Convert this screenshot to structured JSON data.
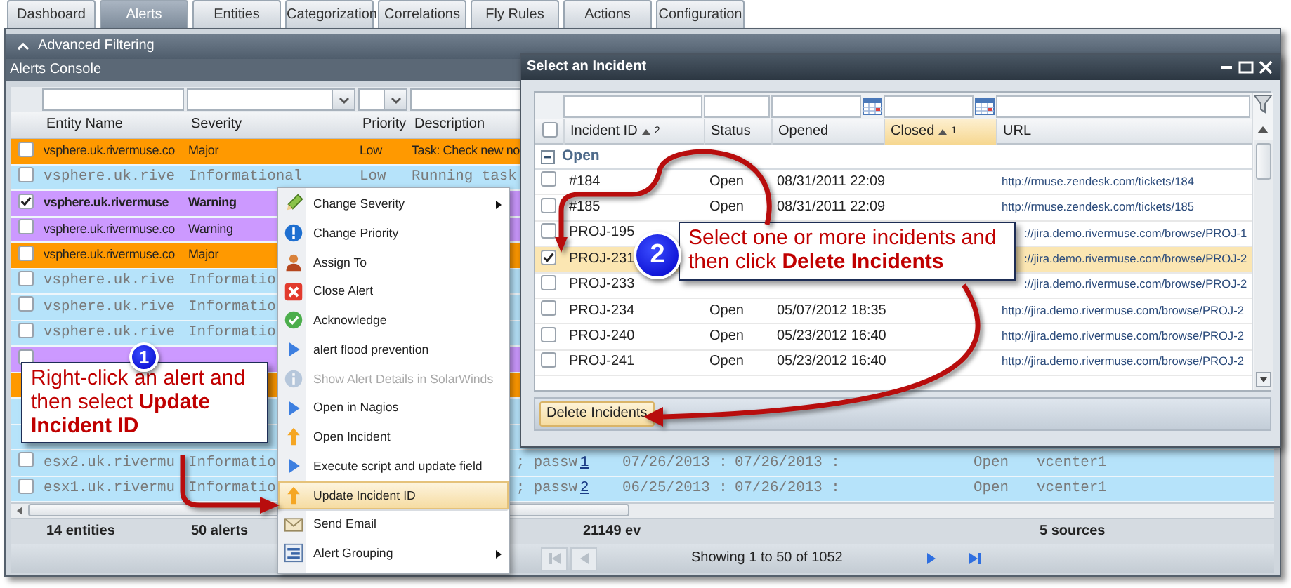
{
  "tabs": [
    {
      "label": "Dashboard",
      "selected": false
    },
    {
      "label": "Alerts",
      "selected": true
    },
    {
      "label": "Entities",
      "selected": false
    },
    {
      "label": "Categorization",
      "selected": false
    },
    {
      "label": "Correlations",
      "selected": false
    },
    {
      "label": "Fly Rules",
      "selected": false
    },
    {
      "label": "Actions",
      "selected": false
    },
    {
      "label": "Configuration",
      "selected": false
    }
  ],
  "filter_panel": {
    "title": "Advanced Filtering",
    "expanded": true
  },
  "console": {
    "title": "Alerts Console",
    "columns": [
      {
        "label": "Entity Name",
        "kind": "text"
      },
      {
        "label": "Severity",
        "kind": "select"
      },
      {
        "label": "Priority",
        "kind": "select"
      },
      {
        "label": "Description",
        "kind": "text"
      }
    ],
    "rows": [
      {
        "kind": "normal",
        "color": "#ff9900",
        "checked": false,
        "selected": false,
        "entity": "vsphere.uk.rivermuse.co",
        "severity": "Major",
        "priority": "Low",
        "description": "Task: Check new no"
      },
      {
        "kind": "informational",
        "color": "#b6e3fa",
        "checked": false,
        "selected": false,
        "entity": "vsphere.uk.rive",
        "severity": "Informational",
        "priority": "Low",
        "description": "Running task"
      },
      {
        "kind": "normal",
        "color": "#cc99ff",
        "checked": true,
        "selected": true,
        "entity": "vsphere.uk.rivermuse",
        "severity": "Warning"
      },
      {
        "kind": "normal",
        "color": "#cc99ff",
        "checked": false,
        "selected": false,
        "entity": "vsphere.uk.rivermuse.co",
        "severity": "Warning"
      },
      {
        "kind": "normal",
        "color": "#ff9900",
        "checked": false,
        "selected": false,
        "entity": "vsphere.uk.rivermuse.co",
        "severity": "Major"
      },
      {
        "kind": "informational",
        "color": "#b6e3fa",
        "checked": false,
        "selected": false,
        "entity": "vsphere.uk.rive",
        "severity": "Informatio"
      },
      {
        "kind": "informational",
        "color": "#b6e3fa",
        "checked": false,
        "selected": false,
        "entity": "vsphere.uk.rive",
        "severity": "Informatio"
      },
      {
        "kind": "informational",
        "color": "#b6e3fa",
        "checked": false,
        "selected": false,
        "entity": "vsphere.uk.rive",
        "severity": "Informatio"
      },
      {
        "kind": "normal",
        "color": "#cc99ff",
        "checked": false
      },
      {
        "kind": "normal",
        "color": "#ff9900"
      },
      {
        "kind": "informational",
        "color": "#b6e3fa"
      },
      {
        "kind": "informational",
        "color": "#b6e3fa"
      },
      {
        "kind": "informational",
        "color": "#b6e3fa",
        "checked": false,
        "selected": false,
        "entity": "esx2.uk.rivermu",
        "severity": "Informatio",
        "description_tail": "; passw",
        "count": "1",
        "first": "07/26/2013 :",
        "last": "07/26/2013 :",
        "state": "Open",
        "connector": "vcenter1"
      },
      {
        "kind": "informational",
        "color": "#b6e3fa",
        "checked": false,
        "selected": false,
        "entity": "esx1.uk.rivermu",
        "severity": "Informatio",
        "description_tail": "; passw",
        "count": "2",
        "first": "06/25/2013 :",
        "last": "07/26/2013 :",
        "state": "Open",
        "connector": "vcenter1"
      }
    ],
    "footer": {
      "entities": "14 entities",
      "alerts": "50 alerts",
      "events": "21149 ev",
      "sources": "5 sources"
    },
    "pager": {
      "status": "Showing 1 to 50 of 1052"
    }
  },
  "context_menu": {
    "groups": [
      [
        {
          "label": "Change Severity",
          "kind": "severity",
          "disabled": false,
          "selected": false,
          "submenu": true
        },
        {
          "label": "Change Priority",
          "kind": "priority",
          "disabled": false,
          "selected": false,
          "submenu": false
        },
        {
          "label": "Assign To",
          "kind": "assign",
          "disabled": false,
          "selected": false,
          "submenu": false
        },
        {
          "label": "Close Alert",
          "kind": "close",
          "disabled": false,
          "selected": false,
          "submenu": false
        },
        {
          "label": "Acknowledge",
          "kind": "acknowledge",
          "disabled": false,
          "selected": false,
          "submenu": false
        },
        {
          "label": "alert flood prevention",
          "kind": "script",
          "disabled": false,
          "selected": false,
          "submenu": false
        },
        {
          "label": "Show Alert Details in SolarWinds",
          "kind": "info",
          "disabled": true,
          "selected": false,
          "submenu": false
        },
        {
          "label": "Open in Nagios",
          "kind": "script",
          "disabled": false,
          "selected": false,
          "submenu": false
        },
        {
          "label": "Open Incident",
          "kind": "incident",
          "disabled": false,
          "selected": false,
          "submenu": false
        },
        {
          "label": "Execute script and update field",
          "kind": "script",
          "disabled": false,
          "selected": false,
          "submenu": false
        }
      ],
      [
        {
          "label": "Update Incident ID",
          "kind": "incident",
          "disabled": false,
          "selected": true,
          "submenu": false
        }
      ],
      [
        {
          "label": "Send Email",
          "kind": "email",
          "disabled": false,
          "selected": false,
          "submenu": false
        },
        {
          "label": "Alert Grouping",
          "kind": "grouping",
          "disabled": false,
          "selected": false,
          "submenu": true
        }
      ]
    ]
  },
  "dialog": {
    "title": "Select an Incident",
    "columns": [
      {
        "label": "Incident ID",
        "sort": "2",
        "selected": false,
        "kind": "text"
      },
      {
        "label": "Status",
        "selected": false,
        "kind": "text"
      },
      {
        "label": "Opened",
        "selected": false,
        "kind": "date"
      },
      {
        "label": "Closed",
        "sort": "1",
        "selected": true,
        "kind": "date"
      },
      {
        "label": "URL",
        "selected": false,
        "kind": "text"
      }
    ],
    "select_all_checked": false,
    "group": {
      "label": "Open",
      "expanded": true
    },
    "rows": [
      {
        "checked": false,
        "selected": false,
        "id": "#184",
        "status": "Open",
        "opened": "08/31/2011 22:09",
        "url": "http://rmuse.zendesk.com/tickets/184"
      },
      {
        "checked": false,
        "selected": false,
        "id": "#185",
        "status": "Open",
        "opened": "08/31/2011 22:09",
        "url": "http://rmuse.zendesk.com/tickets/185"
      },
      {
        "checked": false,
        "selected": false,
        "id": "PROJ-195",
        "url": "://jira.demo.rivermuse.com/browse/PROJ-1"
      },
      {
        "checked": true,
        "selected": true,
        "id": "PROJ-231",
        "url": "://jira.demo.rivermuse.com/browse/PROJ-2"
      },
      {
        "checked": false,
        "selected": false,
        "id": "PROJ-233",
        "url": "://jira.demo.rivermuse.com/browse/PROJ-2"
      },
      {
        "checked": false,
        "selected": false,
        "id": "PROJ-234",
        "status": "Open",
        "opened": "05/07/2012 18:35",
        "url": "http://jira.demo.rivermuse.com/browse/PROJ-2"
      },
      {
        "checked": false,
        "selected": false,
        "id": "PROJ-240",
        "status": "Open",
        "opened": "05/23/2012 16:40",
        "url": "http://jira.demo.rivermuse.com/browse/PROJ-2"
      },
      {
        "checked": false,
        "selected": false,
        "id": "PROJ-241",
        "status": "Open",
        "opened": "05/23/2012 16:40",
        "url": "http://jira.demo.rivermuse.com/browse/PROJ-2"
      }
    ],
    "button": "Delete Incidents"
  },
  "callouts": [
    {
      "number": "1",
      "text": "Right-click an alert and then select **Update Incident ID**"
    },
    {
      "number": "2",
      "text": "Select one or more incidents and then click **Delete Incidents**"
    }
  ]
}
